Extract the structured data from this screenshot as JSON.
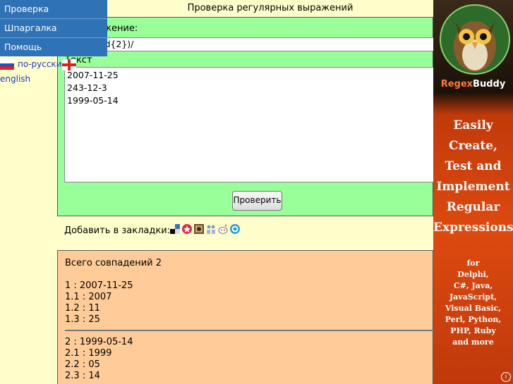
{
  "nav": {
    "items": [
      {
        "label": "Проверка"
      },
      {
        "label": "Шпаргалка"
      },
      {
        "label": "Помощь"
      }
    ]
  },
  "lang": {
    "ru": "по-русски",
    "en": "english"
  },
  "page": {
    "title": "Проверка регулярных выражений"
  },
  "form": {
    "regex_label": "ое выражение:",
    "regex_value": "\\d{2})-(\\d{2})/",
    "text_label": "Текст",
    "text_value": "2007-11-25\n243-12-3\n1999-05-14",
    "button": "Проверить"
  },
  "bookmarks": {
    "label": "Добавить в закладки:"
  },
  "results": {
    "summary": "Всего совпадений 2",
    "groups": [
      {
        "lines": [
          "1 : 2007-11-25",
          "1.1 : 2007",
          "1.2 : 11",
          "1.3 : 25"
        ]
      },
      {
        "lines": [
          "2 : 1999-05-14",
          "2.1 : 1999",
          "2.2 : 05",
          "2.3 : 14"
        ]
      }
    ]
  },
  "ad": {
    "brand_a": "Regex",
    "brand_b": "Buddy",
    "headline": [
      "Easily",
      "Create,",
      "Test and",
      "Implement",
      "Regular",
      "Expressions"
    ],
    "sub": [
      "for",
      "Delphi,",
      "C#, Java,",
      "JavaScript,",
      "Visual Basic,",
      "Perl, Python,",
      "PHP, Ruby",
      "and more"
    ]
  }
}
